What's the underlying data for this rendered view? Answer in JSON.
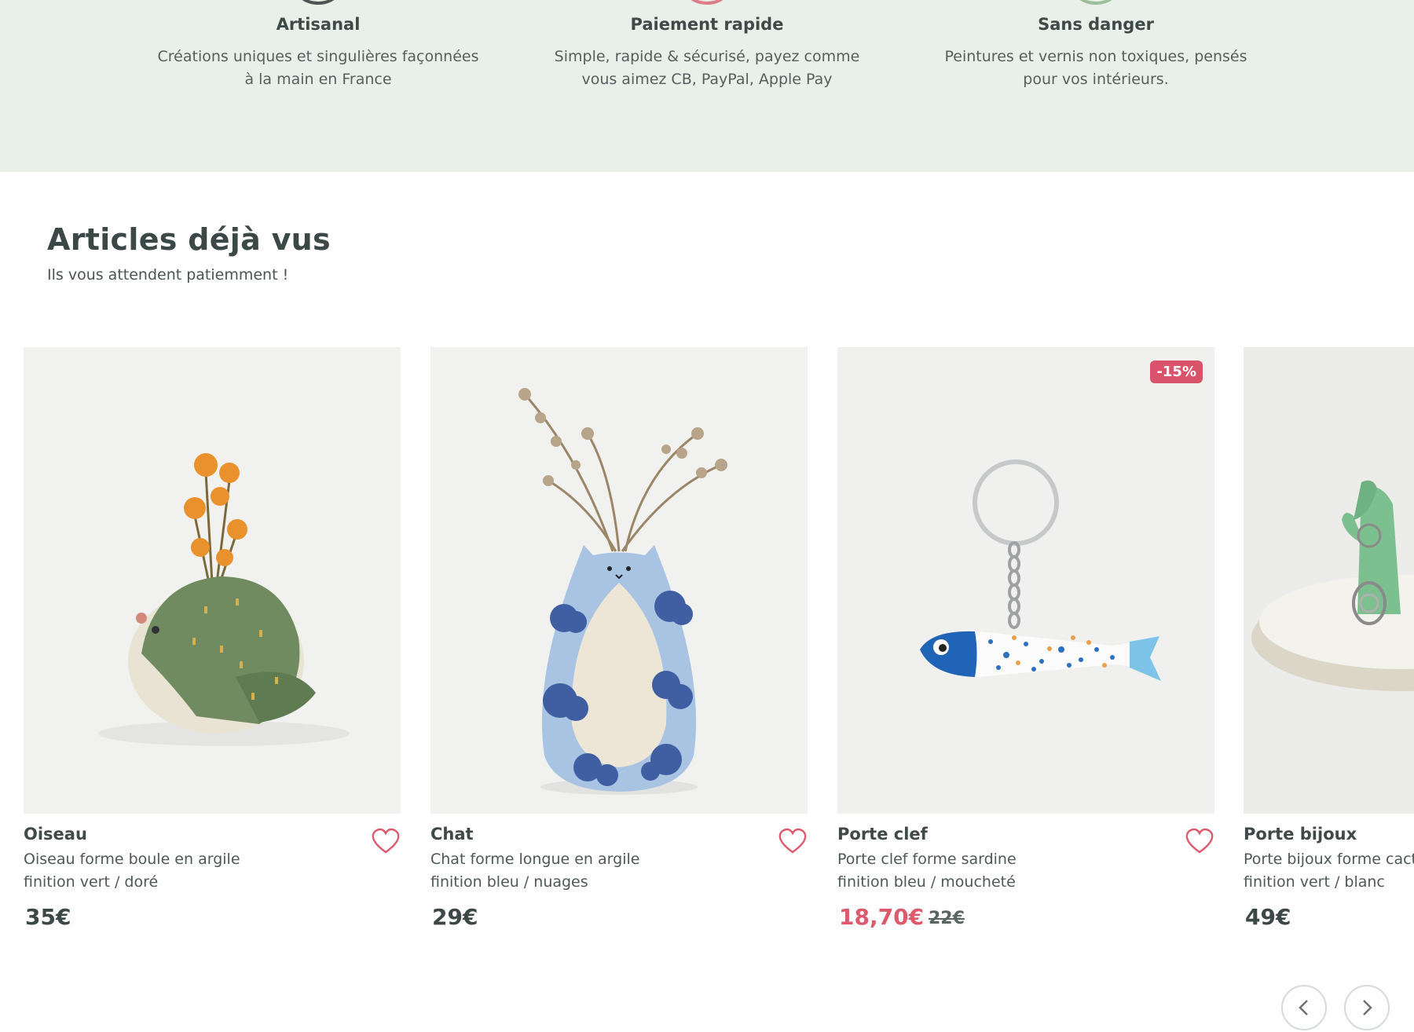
{
  "features": [
    {
      "title": "Artisanal",
      "text": "Créations uniques et singulières façonnées\nà la main en France"
    },
    {
      "title": "Paiement rapide",
      "text": "Simple, rapide & sécurisé, payez comme\nvous aimez CB, PayPal, Apple Pay"
    },
    {
      "title": "Sans danger",
      "text": "Peintures et vernis non toxiques, pensés\npour vos intérieurs."
    }
  ],
  "section": {
    "title": "Articles déjà vus",
    "subtitle": "Ils vous attendent patiemment !"
  },
  "products": [
    {
      "name": "Oiseau",
      "description": "Oiseau forme boule en argile\nfinition vert / doré",
      "price": "35€"
    },
    {
      "name": "Chat",
      "description": "Chat forme longue en argile\nfinition bleu / nuages",
      "price": "29€"
    },
    {
      "name": "Porte clef",
      "description": "Porte clef forme sardine\nfinition bleu / moucheté",
      "price": "18,70€",
      "old_price": "22€",
      "badge": "-15%"
    },
    {
      "name": "Porte bijoux",
      "description": "Porte bijoux forme cactus\nfinition vert / blanc",
      "price": "49€"
    }
  ],
  "colors": {
    "band": "#e9efe9",
    "accent": "#dc5a6c",
    "text": "#3f4a48"
  },
  "icons": [
    "heart-icon",
    "chevron-left-icon",
    "chevron-right-icon"
  ]
}
